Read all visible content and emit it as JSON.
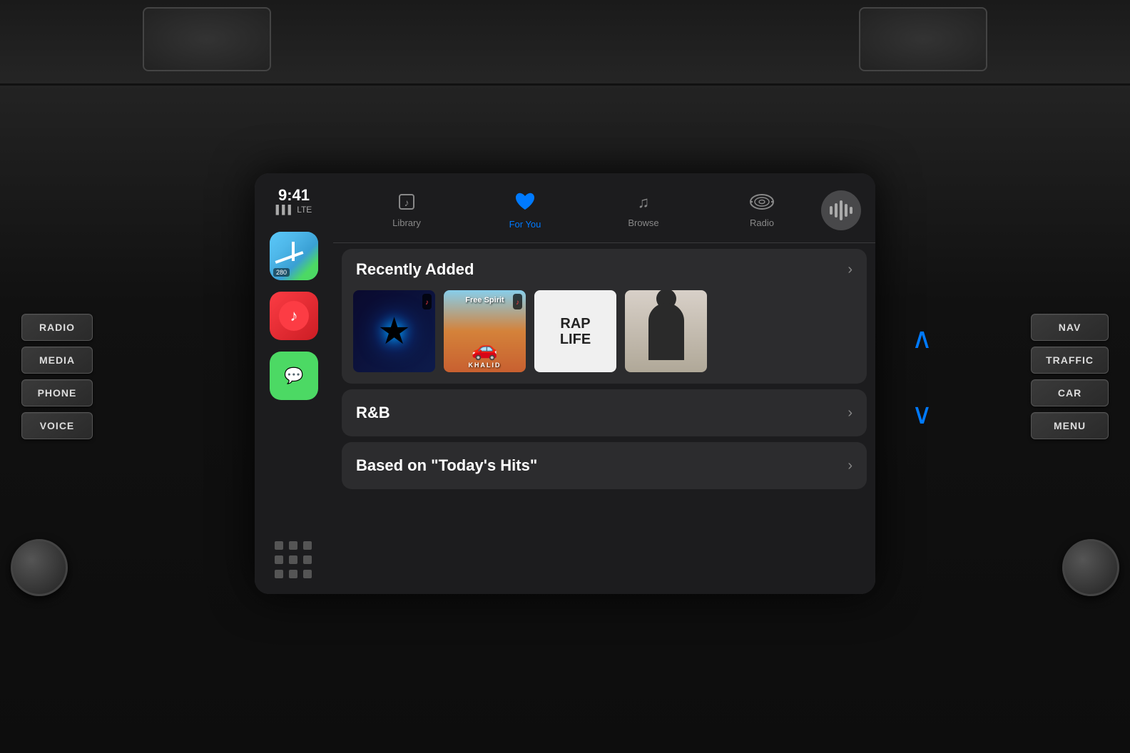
{
  "dashboard": {
    "background": "#1a1a1a"
  },
  "left_buttons": {
    "items": [
      {
        "label": "RADIO",
        "id": "radio"
      },
      {
        "label": "MEDIA",
        "id": "media"
      },
      {
        "label": "PHONE",
        "id": "phone"
      },
      {
        "label": "VOICE",
        "id": "voice"
      }
    ]
  },
  "right_buttons": {
    "items": [
      {
        "label": "NAV",
        "id": "nav"
      },
      {
        "label": "TRAFFIC",
        "id": "traffic"
      },
      {
        "label": "CAR",
        "id": "car"
      },
      {
        "label": "MENU",
        "id": "menu"
      }
    ]
  },
  "status_bar": {
    "time": "9:41",
    "signal": "▌▌▌ LTE"
  },
  "nav_tabs": [
    {
      "label": "Library",
      "icon": "♪",
      "id": "library",
      "active": false
    },
    {
      "label": "For You",
      "icon": "♥",
      "id": "for_you",
      "active": true
    },
    {
      "label": "Browse",
      "icon": "♫",
      "id": "browse",
      "active": false
    },
    {
      "label": "Radio",
      "icon": "📻",
      "id": "radio",
      "active": false
    }
  ],
  "recently_added": {
    "title": "Recently Added",
    "chevron": "›",
    "albums": [
      {
        "id": "star",
        "type": "star"
      },
      {
        "id": "free-spirit",
        "type": "free-spirit"
      },
      {
        "id": "rap-life",
        "type": "rap-life"
      },
      {
        "id": "silhouette",
        "type": "silhouette"
      }
    ]
  },
  "sections": [
    {
      "title": "R&B",
      "id": "rnb"
    },
    {
      "title": "Based on \"Today's Hits\"",
      "id": "todays-hits"
    }
  ],
  "apps": [
    {
      "id": "maps",
      "label": "Maps"
    },
    {
      "id": "music",
      "label": "Music"
    },
    {
      "id": "messages",
      "label": "Messages"
    }
  ],
  "home_grid": {
    "dots": 9
  }
}
